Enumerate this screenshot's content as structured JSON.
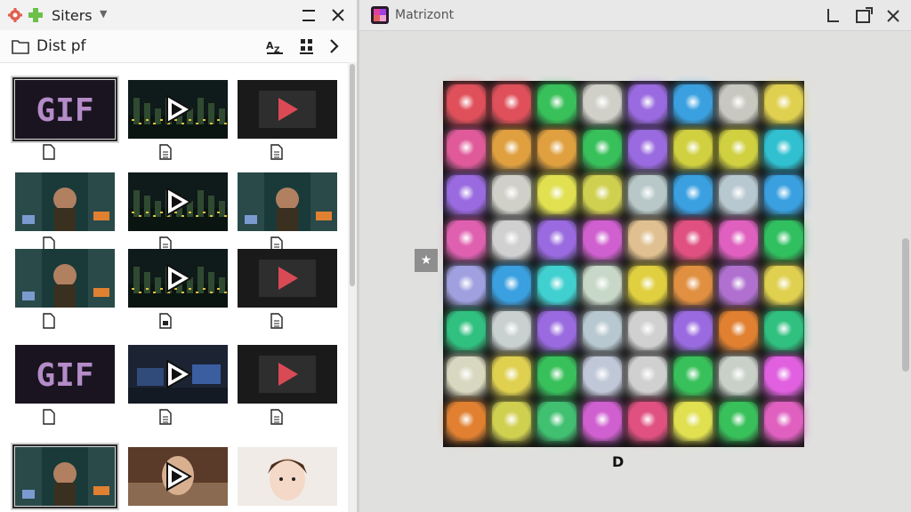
{
  "left_panel": {
    "title": "Siters",
    "path": "Dist pf",
    "thumbnails": [
      [
        {
          "kind": "gif",
          "label": "GIF",
          "selected": true,
          "file": "blank"
        },
        {
          "kind": "video",
          "theme": "city",
          "file": "doc"
        },
        {
          "kind": "play",
          "file": "doc"
        }
      ],
      [
        {
          "kind": "photo",
          "file": "blank"
        },
        {
          "kind": "video",
          "theme": "city",
          "file": "doc"
        },
        {
          "kind": "photo",
          "file": "doc"
        }
      ],
      [
        {
          "kind": "photo",
          "file": "blank"
        },
        {
          "kind": "video",
          "theme": "city",
          "file": "video"
        },
        {
          "kind": "play",
          "file": "doc"
        }
      ],
      [
        {
          "kind": "gif",
          "label": "GIF",
          "file": "blank"
        },
        {
          "kind": "video",
          "theme": "room",
          "file": "doc"
        },
        {
          "kind": "play",
          "file": "doc"
        }
      ],
      [
        {
          "kind": "photo",
          "selected": true
        },
        {
          "kind": "video",
          "theme": "child"
        },
        {
          "kind": "child"
        }
      ]
    ]
  },
  "right_window": {
    "title": "Matrizont",
    "bottom_label": "D",
    "side_button": "★",
    "grid_colors": [
      [
        "#e0505a",
        "#e0505a",
        "#38c05a",
        "#d0d0c8",
        "#9a6ae0",
        "#3aa0e0",
        "#c8c8c0",
        "#e0d050"
      ],
      [
        "#e05a9a",
        "#e0a040",
        "#e0a040",
        "#38c05a",
        "#9a6ae0",
        "#d0d040",
        "#d0d040",
        "#30c0d0"
      ],
      [
        "#9a6ae0",
        "#d0d0c8",
        "#e0e050",
        "#d0d050",
        "#b8c8c8",
        "#3aa0e0",
        "#b8c8d0",
        "#3aa0e0"
      ],
      [
        "#e060b0",
        "#d0d0d0",
        "#9a6ae0",
        "#d060d0",
        "#e0c090",
        "#e05080",
        "#e060c0",
        "#30c060"
      ],
      [
        "#a0a0e0",
        "#3aa0e0",
        "#40d0d0",
        "#c8d8c8",
        "#e0d040",
        "#e09040",
        "#b070d0",
        "#e0d050"
      ],
      [
        "#30c080",
        "#c8d0d0",
        "#9a6ae0",
        "#b8c8d0",
        "#d0d0d0",
        "#9a6ae0",
        "#e08030",
        "#30c080"
      ],
      [
        "#d8d8c0",
        "#e0d050",
        "#38c05a",
        "#c0c8d8",
        "#d0d0d0",
        "#38c05a",
        "#c8d0c8",
        "#e060e0"
      ],
      [
        "#e08030",
        "#d0d050",
        "#40c070",
        "#d060d0",
        "#e05080",
        "#e0e050",
        "#38c05a",
        "#e060c0"
      ]
    ]
  },
  "colors": {
    "play_red": "#d94a55",
    "gif_text": "#b48cc8",
    "canvas_bg": "#151515"
  },
  "icons": {
    "left_app": "gear-and-plus-icon",
    "folder": "folder-icon",
    "star": "star-icon"
  }
}
